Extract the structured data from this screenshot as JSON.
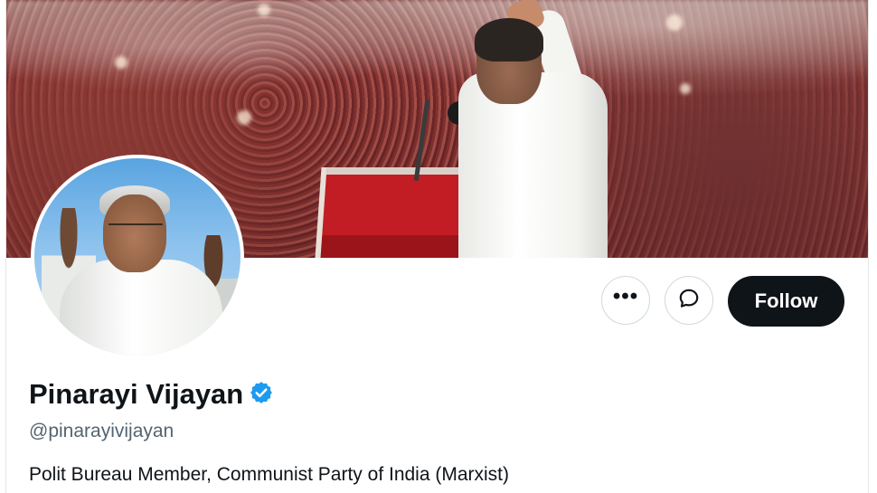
{
  "profile": {
    "display_name": "Pinarayi Vijayan",
    "handle": "@pinarayivijayan",
    "bio": "Polit Bureau Member, Communist Party of India (Marxist)",
    "verified": true
  },
  "actions": {
    "more_label": "•••",
    "message_icon": "message-bubble-icon",
    "follow_label": "Follow"
  },
  "colors": {
    "verified_badge": "#1d9bf0",
    "follow_bg": "#0f1419",
    "handle_text": "#536471"
  }
}
